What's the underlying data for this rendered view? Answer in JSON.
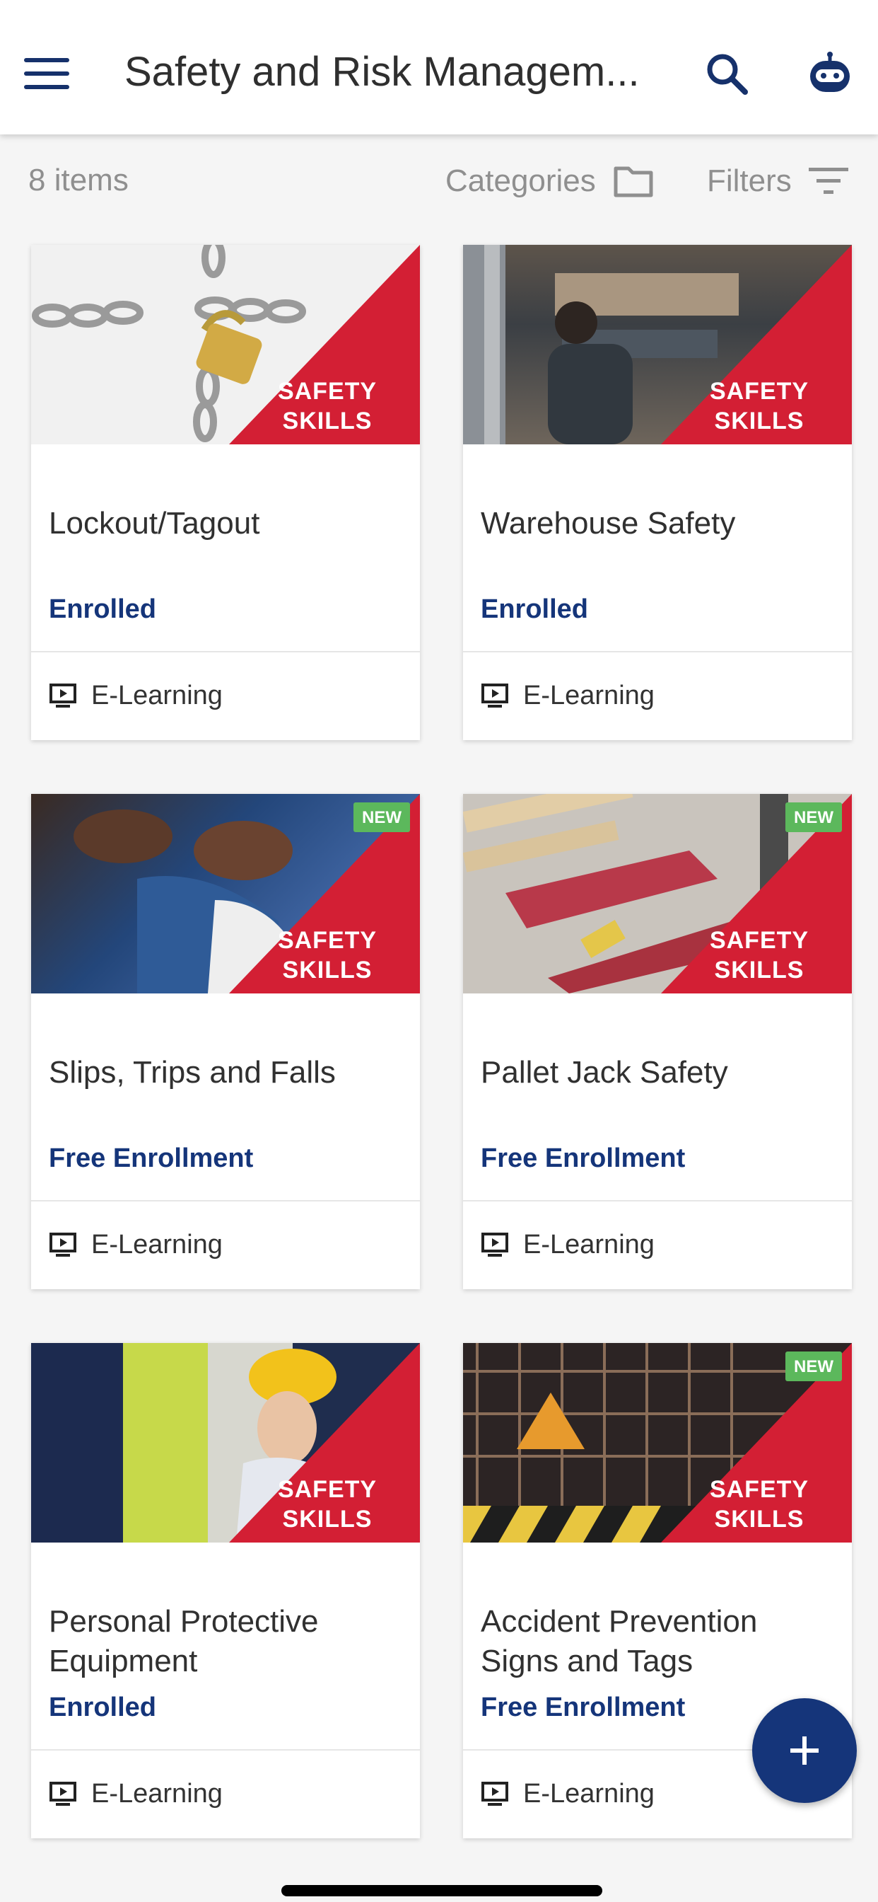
{
  "header": {
    "title": "Safety and Risk Managem...",
    "menu_icon": "hamburger-menu-icon",
    "search_icon": "search-icon",
    "assistant_icon": "robot-assistant-icon"
  },
  "toolbar": {
    "item_count": "8 items",
    "categories_label": "Categories",
    "filters_label": "Filters"
  },
  "brand": {
    "line1": "SAFETY",
    "line2": "SKILLS"
  },
  "courses": [
    {
      "title": "Lockout/Tagout",
      "status": "Enrolled",
      "type": "E-Learning",
      "new_badge": ""
    },
    {
      "title": "Warehouse Safety",
      "status": "Enrolled",
      "type": "E-Learning",
      "new_badge": ""
    },
    {
      "title": "Slips, Trips and Falls",
      "status": "Free Enrollment",
      "type": "E-Learning",
      "new_badge": "NEW"
    },
    {
      "title": "Pallet Jack Safety",
      "status": "Free Enrollment",
      "type": "E-Learning",
      "new_badge": "NEW"
    },
    {
      "title": "Personal Protective Equipment",
      "status": "Enrolled",
      "type": "E-Learning",
      "new_badge": ""
    },
    {
      "title": "Accident Prevention Signs and Tags",
      "status": "Free Enrollment",
      "type": "E-Learning",
      "new_badge": "NEW"
    }
  ],
  "fab": {
    "icon": "plus-icon"
  },
  "colors": {
    "primary": "#15357a",
    "brand_red": "#d31f34",
    "new_green": "#5cb85c"
  }
}
